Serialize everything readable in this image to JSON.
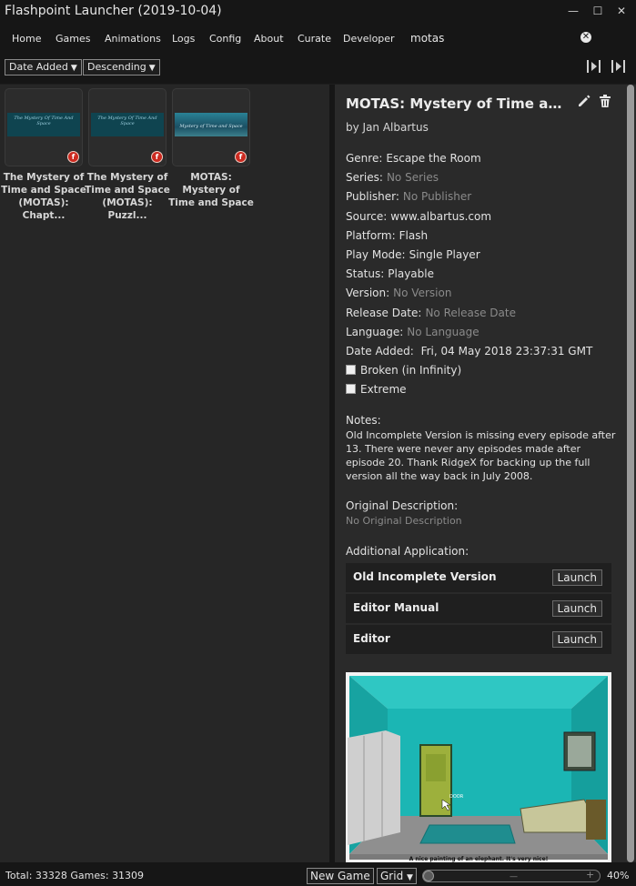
{
  "window": {
    "title": "Flashpoint Launcher (2019-10-04)",
    "minimize_glyph": "—",
    "maximize_glyph": "☐",
    "close_glyph": "✕"
  },
  "menu": {
    "items": [
      "Home",
      "Games",
      "Animations",
      "Logs",
      "Config",
      "About",
      "Curate",
      "Developer"
    ],
    "search_value": "motas",
    "clear_glyph": "✕"
  },
  "toolbar": {
    "sort_by": "Date Added",
    "sort_order": "Descending",
    "dropdown_arrow": "▼"
  },
  "games": [
    {
      "title": "The Mystery of Time and Space (MOTAS): Chapt...",
      "banner": "The Mystery Of Time And Space"
    },
    {
      "title": "The Mystery of Time and Space (MOTAS): Puzzl...",
      "banner": "The Mystery Of Time And Space"
    },
    {
      "title": "MOTAS: Mystery of Time and Space",
      "banner": "Mystery of Time and Space"
    }
  ],
  "details": {
    "title": "MOTAS: Mystery of Time and S...",
    "author": "by Jan Albartus",
    "fields": [
      {
        "label": "Genre:",
        "value": "Escape the Room",
        "empty": false
      },
      {
        "label": "Series:",
        "value": "No Series",
        "empty": true
      },
      {
        "label": "Publisher:",
        "value": "No Publisher",
        "empty": true
      },
      {
        "label": "Source:",
        "value": "www.albartus.com",
        "empty": false
      },
      {
        "label": "Platform:",
        "value": "Flash",
        "empty": false
      },
      {
        "label": "Play Mode:",
        "value": "Single Player",
        "empty": false
      },
      {
        "label": "Status:",
        "value": "Playable",
        "empty": false
      },
      {
        "label": "Version:",
        "value": "No Version",
        "empty": true
      },
      {
        "label": "Release Date:",
        "value": "No Release Date",
        "empty": true
      },
      {
        "label": "Language:",
        "value": "No Language",
        "empty": true
      },
      {
        "label": "Date Added:",
        "value": " Fri, 04 May 2018 23:37:31 GMT",
        "empty": false
      }
    ],
    "checkboxes": [
      {
        "label": "Broken (in Infinity)",
        "checked": false
      },
      {
        "label": "Extreme",
        "checked": false
      }
    ],
    "notes_label": "Notes:",
    "notes": "Old Incomplete Version is missing every episode after 13. There were never any episodes made after episode 20. Thank RidgeX for backing up the full version all the way back in July 2008.",
    "original_description_label": "Original Description:",
    "original_description": "No Original Description",
    "additional_label": "Additional Application:",
    "additional_apps": [
      {
        "name": "Old Incomplete Version",
        "action": "Launch"
      },
      {
        "name": "Editor Manual",
        "action": "Launch"
      },
      {
        "name": "Editor",
        "action": "Launch"
      }
    ],
    "screenshot": {
      "door_label": "DOOR",
      "caption": "A nice painting of an elephant. It's very nice!"
    }
  },
  "status": {
    "stats": "Total: 33328 Games: 31309",
    "new_game": "New Game",
    "view_mode": "Grid",
    "zoom_percent": "40%",
    "zoom_value": 0.0,
    "minus_glyph": "—",
    "plus_glyph": "+"
  },
  "colors": {
    "background": "#1e1e1e",
    "panel": "#2a2a2a",
    "flash_badge": "#cc2a20",
    "room_wall": "#1bb6b4"
  }
}
